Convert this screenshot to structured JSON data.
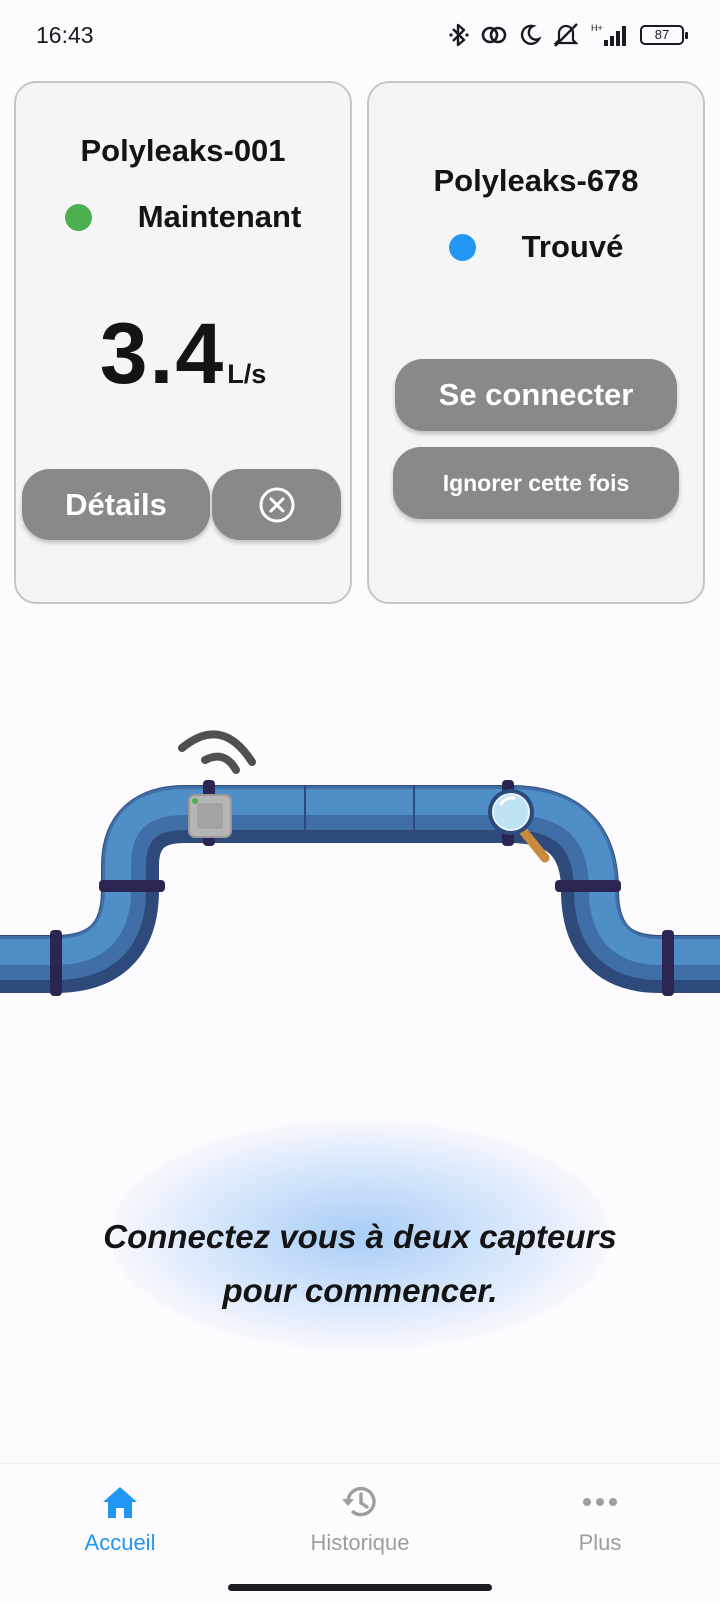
{
  "status_bar": {
    "time": "16:43",
    "battery": "87",
    "network": "H+",
    "icons": [
      "bluetooth-icon",
      "sync-icon",
      "moon-icon",
      "mute-icon",
      "signal-icon",
      "battery-icon"
    ]
  },
  "sensors": [
    {
      "name": "Polyleaks-001",
      "status": "Maintenant",
      "status_color": "#4caf50",
      "value": "3.4",
      "unit": "L/s",
      "details_label": "Détails",
      "close_icon": "close-circle-icon"
    },
    {
      "name": "Polyleaks-678",
      "status": "Trouvé",
      "status_color": "#2196f3",
      "connect_label": "Se connecter",
      "ignore_label": "Ignorer cette fois"
    }
  ],
  "illustration": {
    "icons": [
      "wifi-signal-icon",
      "sensor-box-icon",
      "magnifier-icon",
      "pipe-illustration"
    ],
    "colors": {
      "pipe_light": "#4f8ec7",
      "pipe_mid": "#3f6fa6",
      "pipe_dark": "#2e4a7a",
      "joint": "#2b2552"
    }
  },
  "instruction": {
    "line1": "Connectez vous à deux capteurs",
    "line2": "pour commencer."
  },
  "nav": {
    "items": [
      {
        "label": "Accueil",
        "icon": "home-icon",
        "active": true
      },
      {
        "label": "Historique",
        "icon": "history-icon",
        "active": false
      },
      {
        "label": "Plus",
        "icon": "more-icon",
        "active": false
      }
    ],
    "active_color": "#2196f3",
    "inactive_color": "#9e9e9e"
  }
}
